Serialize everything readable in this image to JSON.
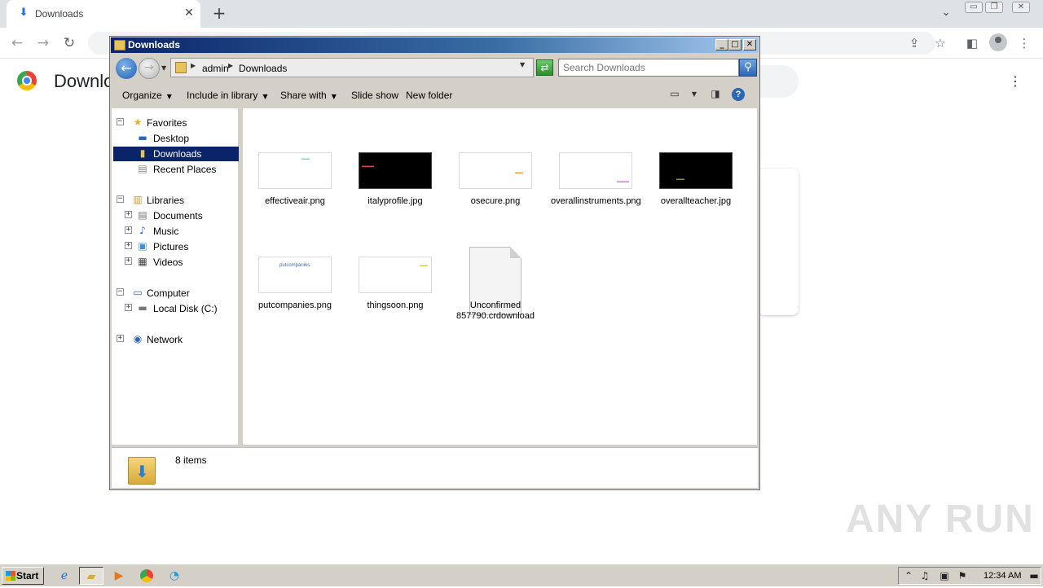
{
  "browser": {
    "tab_title": "Downloads",
    "tab_icon": "download-icon",
    "new_tab_label": "+",
    "page_heading": "Downlo",
    "window_controls": [
      "minimize",
      "restore",
      "close"
    ]
  },
  "explorer": {
    "title": "Downloads",
    "address_crumbs": [
      "admin",
      "Downloads"
    ],
    "search_placeholder": "Search Downloads",
    "commands": [
      {
        "label": "Organize",
        "dropdown": true
      },
      {
        "label": "Include in library",
        "dropdown": true
      },
      {
        "label": "Share with",
        "dropdown": true
      },
      {
        "label": "Slide show",
        "dropdown": false
      },
      {
        "label": "New folder",
        "dropdown": false
      }
    ],
    "nav_tree": {
      "favorites": {
        "label": "Favorites",
        "items": [
          "Desktop",
          "Downloads",
          "Recent Places"
        ],
        "selected": "Downloads"
      },
      "libraries": {
        "label": "Libraries",
        "items": [
          "Documents",
          "Music",
          "Pictures",
          "Videos"
        ]
      },
      "computer": {
        "label": "Computer",
        "items": [
          "Local Disk (C:)"
        ]
      },
      "network": {
        "label": "Network"
      }
    },
    "files": [
      {
        "name": "effectiveair.png",
        "thumb": "light",
        "mark_color": "#7ad6d6"
      },
      {
        "name": "italyprofile.jpg",
        "thumb": "dark",
        "mark_color": "#e04040"
      },
      {
        "name": "osecure.png",
        "thumb": "light",
        "mark_color": "#f0a040"
      },
      {
        "name": "overallinstruments.png",
        "thumb": "light",
        "mark_color": "#e070e0"
      },
      {
        "name": "overallteacher.jpg",
        "thumb": "dark",
        "mark_color": "#7a9c3a"
      },
      {
        "name": "putcompanies.png",
        "thumb": "light",
        "mark_color": "#4a6aa8",
        "mark_text": "putcompanies"
      },
      {
        "name": "thingsoon.png",
        "thumb": "light",
        "mark_color": "#d6d650"
      },
      {
        "name": "Unconfirmed 857790.crdownload",
        "thumb": "document"
      }
    ],
    "status": {
      "count_text": "8 items"
    }
  },
  "taskbar": {
    "start_label": "Start",
    "apps": [
      "internet-explorer-icon",
      "explorer-icon",
      "media-player-icon",
      "chrome-icon",
      "edge-icon"
    ],
    "clock": "12:34 AM"
  },
  "watermark": "ANY RUN"
}
